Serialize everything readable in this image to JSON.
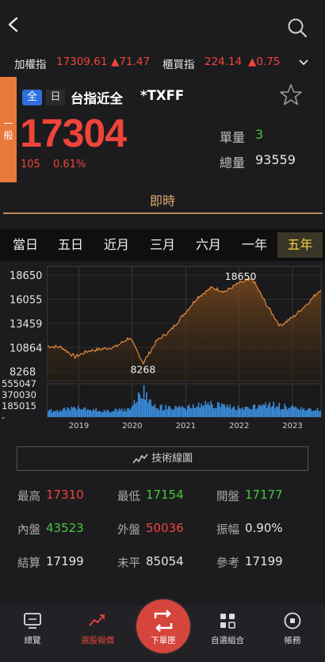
{
  "nav": {
    "back_icon": "chevron-left-icon",
    "search_icon": "search-icon"
  },
  "ticker": {
    "taiex_label": "加權指",
    "taiex_value": "17309.61",
    "taiex_change": "▲71.47",
    "otc_label": "櫃買指",
    "otc_value": "224.14",
    "otc_change": "▲0.75",
    "expand_icon": "chevron-down-icon"
  },
  "quote": {
    "side_tab": [
      "一",
      "般"
    ],
    "badge_all": "全",
    "badge_day": "日",
    "name": "台指近全",
    "code": "*TXFF",
    "price": "17304",
    "change": "105",
    "change_pct": "0.61%",
    "unit_volume_label": "單量",
    "unit_volume_value": "3",
    "total_volume_label": "總量",
    "total_volume_value": "93559",
    "favorite_icon": "star-outline-icon"
  },
  "section_title": "即時",
  "ranges": [
    "當日",
    "五日",
    "近月",
    "三月",
    "六月",
    "一年",
    "五年"
  ],
  "active_range": "五年",
  "chart_data": {
    "type": "line",
    "x": [
      "2018-06",
      "2018-09",
      "2018-12",
      "2019-03",
      "2019-06",
      "2019-09",
      "2019-12",
      "2020-03",
      "2020-06",
      "2020-09",
      "2020-12",
      "2021-03",
      "2021-06",
      "2021-09",
      "2021-12",
      "2022-03",
      "2022-06",
      "2022-09",
      "2022-12",
      "2023-03",
      "2023-06"
    ],
    "series": [
      {
        "values": [
          11000,
          10900,
          9850,
          10500,
          10700,
          10950,
          11950,
          9200,
          11600,
          12700,
          14500,
          16300,
          17300,
          16900,
          17800,
          18200,
          15500,
          13200,
          14200,
          15600,
          17200
        ]
      }
    ],
    "volume": [
      120000,
      140000,
      185000,
      150000,
      130000,
      140000,
      150000,
      520000,
      200000,
      180000,
      170000,
      230000,
      260000,
      220000,
      190000,
      210000,
      250000,
      220000,
      180000,
      160000,
      150000
    ],
    "ylim": [
      7300,
      19600
    ],
    "y_ticks": [
      "18650",
      "16055",
      "13459",
      "10864",
      "8268"
    ],
    "volume_ticks": [
      "555047",
      "370030",
      "185015",
      "-"
    ],
    "x_ticks": [
      "2019",
      "2020",
      "2021",
      "2022",
      "2023"
    ],
    "annotations": {
      "high": "18650",
      "low": "8268"
    },
    "line_color": "#e0893a",
    "volume_color": "#3b8fe0"
  },
  "tech_button": "技術線圖",
  "tech_icon": "line-chart-icon",
  "stats": [
    {
      "label": "最高",
      "value": "17310",
      "color": "red"
    },
    {
      "label": "最低",
      "value": "17154",
      "color": "green"
    },
    {
      "label": "開盤",
      "value": "17177",
      "color": "green"
    },
    {
      "label": "內盤",
      "value": "43523",
      "color": "green"
    },
    {
      "label": "外盤",
      "value": "50036",
      "color": "red"
    },
    {
      "label": "振幅",
      "value": "0.90%",
      "color": "white"
    },
    {
      "label": "結算",
      "value": "17199",
      "color": "white"
    },
    {
      "label": "未平",
      "value": "85054",
      "color": "white"
    },
    {
      "label": "參考",
      "value": "17199",
      "color": "white"
    }
  ],
  "bottom_nav": [
    {
      "label": "總覽",
      "icon": "monitor-icon"
    },
    {
      "label": "選股報價",
      "icon": "trend-icon"
    },
    {
      "label": "下單匣",
      "icon": "repeat-icon"
    },
    {
      "label": "自選組合",
      "icon": "grid-icon"
    },
    {
      "label": "帳務",
      "icon": "circle-dot-icon"
    }
  ],
  "colors": {
    "up": "#f0443a",
    "down": "#49c53b",
    "accent": "#e0a96d",
    "brand": "#d6453c"
  }
}
